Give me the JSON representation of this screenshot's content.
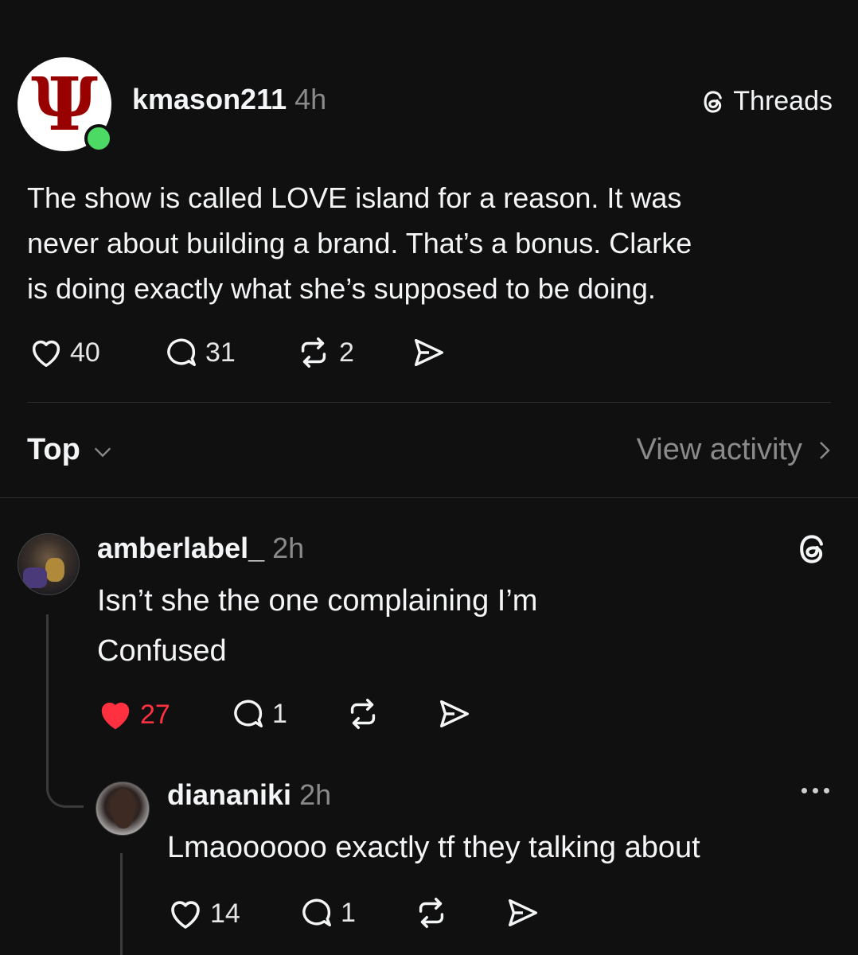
{
  "post": {
    "username": "kmason211",
    "time": "4h",
    "brand_label": "Threads",
    "text_lines": [
      "The show is called LOVE island for a reason. It was",
      "never about building a brand. That’s a bonus. Clarke",
      "is doing exactly what she’s supposed to be doing."
    ],
    "likes": "40",
    "replies": "31",
    "reposts": "2",
    "avatar_letter": "Ψ"
  },
  "sort": {
    "label": "Top",
    "view_activity": "View activity"
  },
  "replies": [
    {
      "username": "amberlabel_",
      "time": "2h",
      "text_lines": [
        "Isn’t she the one complaining I’m",
        "Confused"
      ],
      "likes": "27",
      "replies": "1",
      "liked": true
    },
    {
      "username": "diananiki",
      "time": "2h",
      "text_lines": [
        "Lmaoooooo exactly tf they talking about"
      ],
      "likes": "14",
      "replies": "1",
      "liked": false
    }
  ],
  "colors": {
    "background": "#101010",
    "text": "#f3f5f7",
    "muted": "#8a8a8a",
    "like_red": "#ff3040",
    "online_green": "#4cd964",
    "avatar_crimson": "#990000"
  },
  "icons": [
    "heart-icon",
    "comment-icon",
    "repost-icon",
    "share-icon",
    "threads-logo-icon",
    "chevron-down-icon",
    "chevron-right-icon",
    "more-icon"
  ]
}
